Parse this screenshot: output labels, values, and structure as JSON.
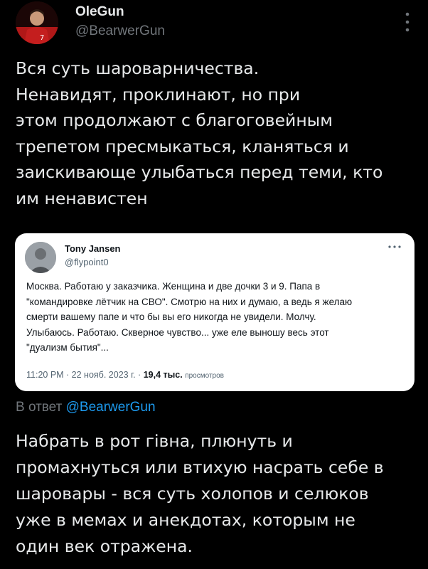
{
  "author": {
    "display_name": "OleGun",
    "handle": "@BearwerGun",
    "avatar_icon": "user-avatar-football-player"
  },
  "tweet": {
    "text": "Вся суть шароварничества.\nНенавидят, проклинают, но при\nэтом продолжают с благоговейным\nтрепетом пресмыкаться, кланяться и\nзаискивающе улыбаться перед теми, кто\nим ненавистен"
  },
  "quoted": {
    "display_name": "Tony Jansen",
    "handle": "@flypoint0",
    "text": "Москва. Работаю у заказчика. Женщина и две дочки 3 и 9. Папа в\n\"командировке лётчик на СВО\". Смотрю на них и думаю, а ведь я желаю\nсмерти вашему папе и что бы вы его никогда не увидели. Молчу.\nУлыбаюсь. Работаю. Скверное чувство... уже еле выношу весь этот\n\"дуализм бытия\"...",
    "timestamp": "11:20 PM · 22 нояб. 2023 г. · ",
    "views_count": "19,4 тыс.",
    "views_label": "просмотров"
  },
  "reply": {
    "prefix": "В ответ ",
    "mention": "@BearwerGun",
    "text": "Набрать в рот гівна, плюнуть и\nпромахнуться или втихую насрать себе в\nшаровары - вся суть холопов и селюков\nуже в мемах и анекдотах, которым не\nодин век отражена."
  },
  "colors": {
    "background": "#000000",
    "text_primary": "#e7e9ea",
    "text_secondary": "#71767b",
    "link": "#1d9bf0",
    "card_background": "#ffffff"
  }
}
